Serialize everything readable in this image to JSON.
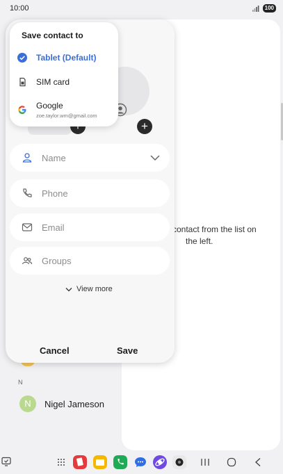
{
  "status": {
    "time": "10:00",
    "battery": "100"
  },
  "popup": {
    "title": "Save contact to",
    "options": [
      {
        "label": "Tablet (Default)",
        "selected": true,
        "icon": "check-circle-icon"
      },
      {
        "label": "SIM card",
        "selected": false,
        "icon": "sim-card-icon"
      },
      {
        "label": "Google",
        "sub": "zoe.taylor.wm@gmail.com",
        "selected": false,
        "icon": "google-icon"
      }
    ]
  },
  "form": {
    "name_placeholder": "Name",
    "phone_placeholder": "Phone",
    "email_placeholder": "Email",
    "groups_placeholder": "Groups",
    "view_more": "View more",
    "cancel": "Cancel",
    "save": "Save"
  },
  "right_panel": {
    "hint_line1": "contact from the list on",
    "hint_line2": "the left."
  },
  "background_list": {
    "section_letter": "N",
    "contact_initial": "N",
    "contact_name": "Nigel Jameson"
  },
  "colors": {
    "accent": "#3b6ed8",
    "avatar": "#b9d98e"
  }
}
